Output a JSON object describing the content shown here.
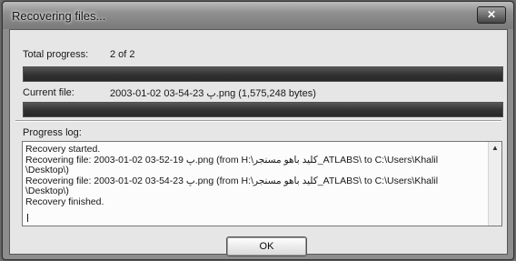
{
  "window": {
    "title": "Recovering files...",
    "close_glyph": "✕"
  },
  "total_progress": {
    "label": "Total progress:",
    "value": "2 of 2",
    "fraction": 1.0
  },
  "current_file": {
    "label": "Current file:",
    "value": "2003-01-02 03-54-23 پ.png (1,575,248 bytes)",
    "fraction": 1.0
  },
  "progress_log": {
    "label": "Progress log:",
    "lines": [
      "Recovery started.",
      "Recovering file: 2003-01-02 03-52-19 پ.png (from H:\\کلید باهو مسنجر_ATLABS\\ to C:\\Users\\Khalil",
      "\\Desktop\\)",
      "Recovering file: 2003-01-02 03-54-23 پ.png (from H:\\کلید باهو مسنجر_ATLABS\\ to C:\\Users\\Khalil",
      "\\Desktop\\)",
      "Recovery finished."
    ],
    "scroll_up_icon": "▲"
  },
  "buttons": {
    "ok_label": "OK"
  },
  "colors": {
    "progress_fill": "#3a3a3a",
    "dialog_background": "#dedede"
  }
}
